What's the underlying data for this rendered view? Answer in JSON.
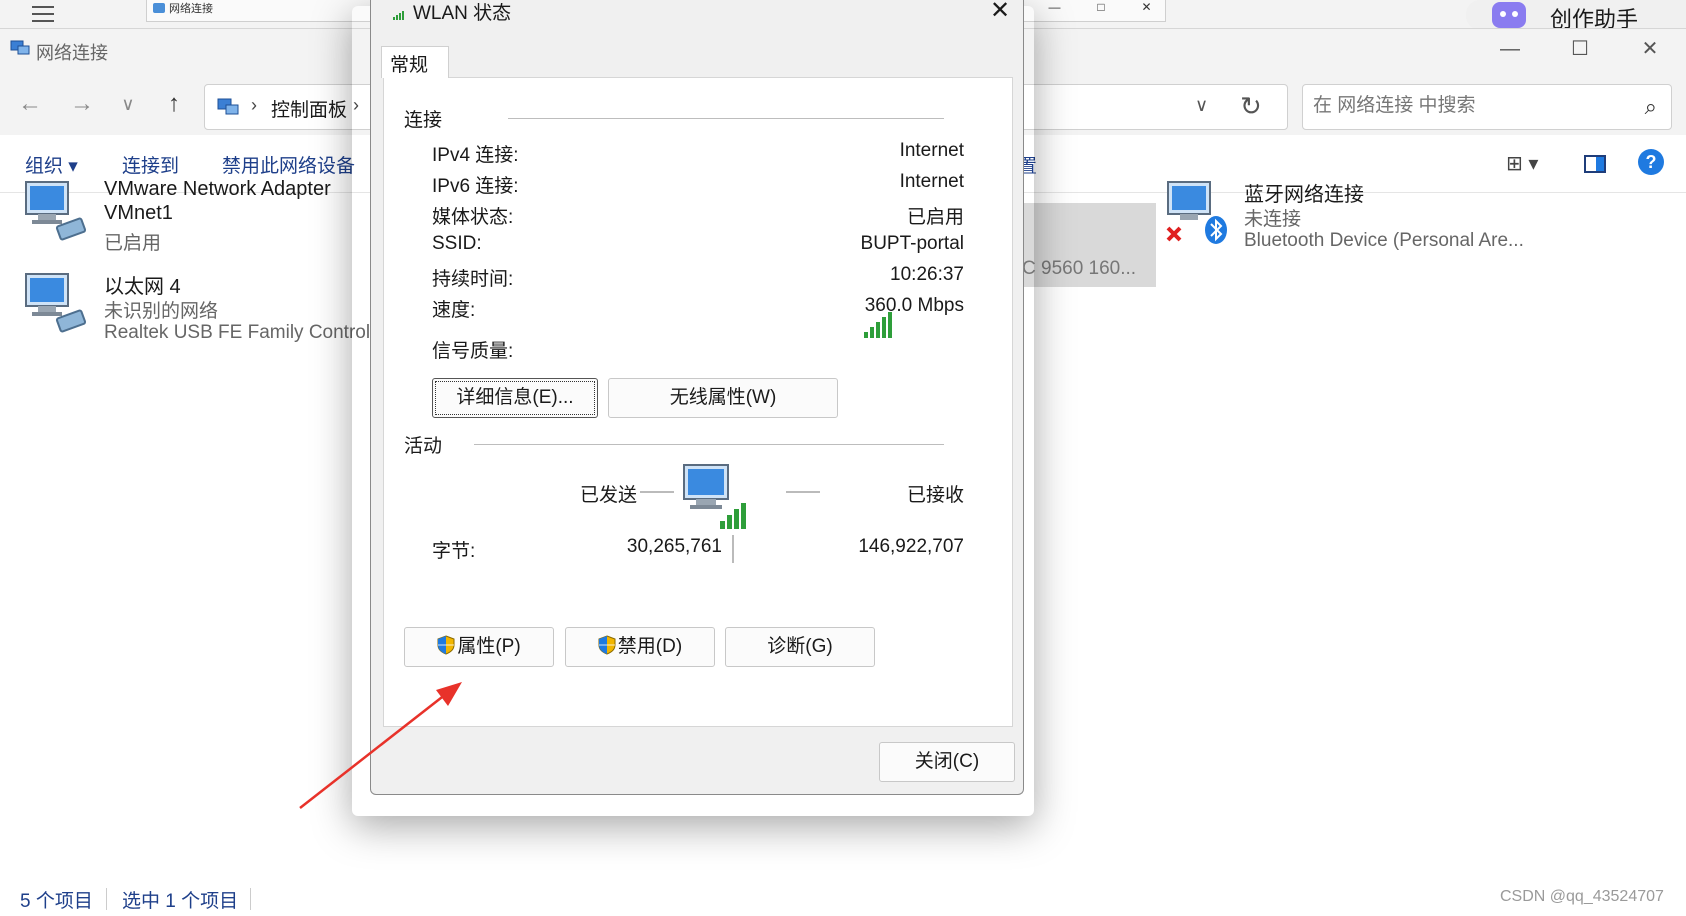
{
  "background": {
    "mini_window_title": "网络连接",
    "mini_controls": [
      "—",
      "□",
      "✕"
    ],
    "assistant_label": "创作助手"
  },
  "explorer": {
    "title": "网络连接",
    "controls": {
      "minimize": "—",
      "maximize": "☐",
      "close": "✕"
    },
    "nav": {
      "back": "←",
      "forward": "→",
      "recent": "∨",
      "up": "↑"
    },
    "address": {
      "separator": "›",
      "crumb": "控制面板",
      "dropdown": "∨",
      "refresh": "↻"
    },
    "search": {
      "placeholder": "在 网络连接 中搜索",
      "value": ""
    },
    "commands": {
      "organize": "组织 ▾",
      "connect": "连接到",
      "disable": "禁用此网络设备",
      "setting_partial": "置"
    },
    "view_toggle": "⊞ ▾",
    "help": "?",
    "items": [
      {
        "name_line1": "VMware Network Adapter",
        "name_line2": "VMnet1",
        "status": "已启用"
      },
      {
        "name_line1": "以太网 4",
        "status": "未识别的网络",
        "device": "Realtek USB FE Family Controll..."
      },
      {
        "name_line1": "蓝牙网络连接",
        "status": "未连接",
        "device": "Bluetooth Device (Personal Are..."
      }
    ],
    "selected_item_partial": "C 9560 160...",
    "statusbar": {
      "count": "5 个项目",
      "selected": "选中 1 个项目"
    },
    "watermark": "CSDN @qq_43524707"
  },
  "dialog": {
    "title": "WLAN 状态",
    "close": "✕",
    "tab": "常规",
    "connection_group": "连接",
    "rows": [
      {
        "label": "IPv4 连接:",
        "value": "Internet"
      },
      {
        "label": "IPv6 连接:",
        "value": "Internet"
      },
      {
        "label": "媒体状态:",
        "value": "已启用"
      },
      {
        "label": "SSID:",
        "value": "BUPT-portal"
      },
      {
        "label": "持续时间:",
        "value": "10:26:37"
      },
      {
        "label": "速度:",
        "value": "360.0 Mbps"
      }
    ],
    "signal_label": "信号质量:",
    "signal_level_bars": 5,
    "details_button": "详细信息(E)...",
    "wireless_button": "无线属性(W)",
    "activity_group": "活动",
    "sent_label": "已发送",
    "received_label": "已接收",
    "bytes_label": "字节:",
    "bytes_sent": "30,265,761",
    "bytes_received": "146,922,707",
    "properties_button": "属性(P)",
    "disable_button": "禁用(D)",
    "diagnose_button": "诊断(G)",
    "close_button": "关闭(C)"
  },
  "colors": {
    "accent": "#1f7ae0",
    "link": "#1e3f8a",
    "arrow": "#e8322a",
    "signal": "#2e9e3a"
  }
}
